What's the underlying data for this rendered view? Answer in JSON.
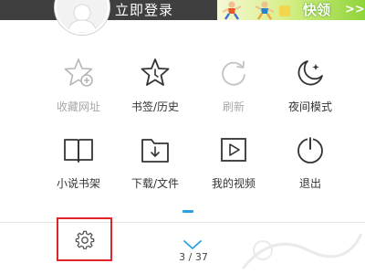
{
  "header": {
    "login_text": "立即登录",
    "ad_text": "快领",
    "ad_arrows": ">>"
  },
  "menu": {
    "row1": [
      {
        "label": "收藏网址",
        "icon": "star-add-icon",
        "enabled": false
      },
      {
        "label": "书签/历史",
        "icon": "star-clock-icon",
        "enabled": true
      },
      {
        "label": "刷新",
        "icon": "refresh-icon",
        "enabled": false
      },
      {
        "label": "夜间模式",
        "icon": "moon-icon",
        "enabled": true
      }
    ],
    "row2": [
      {
        "label": "小说书架",
        "icon": "book-icon",
        "enabled": true
      },
      {
        "label": "下载/文件",
        "icon": "folder-download-icon",
        "enabled": true
      },
      {
        "label": "我的视频",
        "icon": "video-play-icon",
        "enabled": true
      },
      {
        "label": "退出",
        "icon": "power-icon",
        "enabled": true
      }
    ]
  },
  "bottom_bar": {
    "settings_icon": "gear-icon",
    "collapse_icon": "chevron-down-icon",
    "page_counter": "3 / 37"
  },
  "colors": {
    "header_bg": "#3f3f3f",
    "accent_blue": "#2aa1e0",
    "highlight_red": "#e0262a",
    "disabled_text": "#a8a8a8",
    "ad_green": "#8fd43a"
  }
}
